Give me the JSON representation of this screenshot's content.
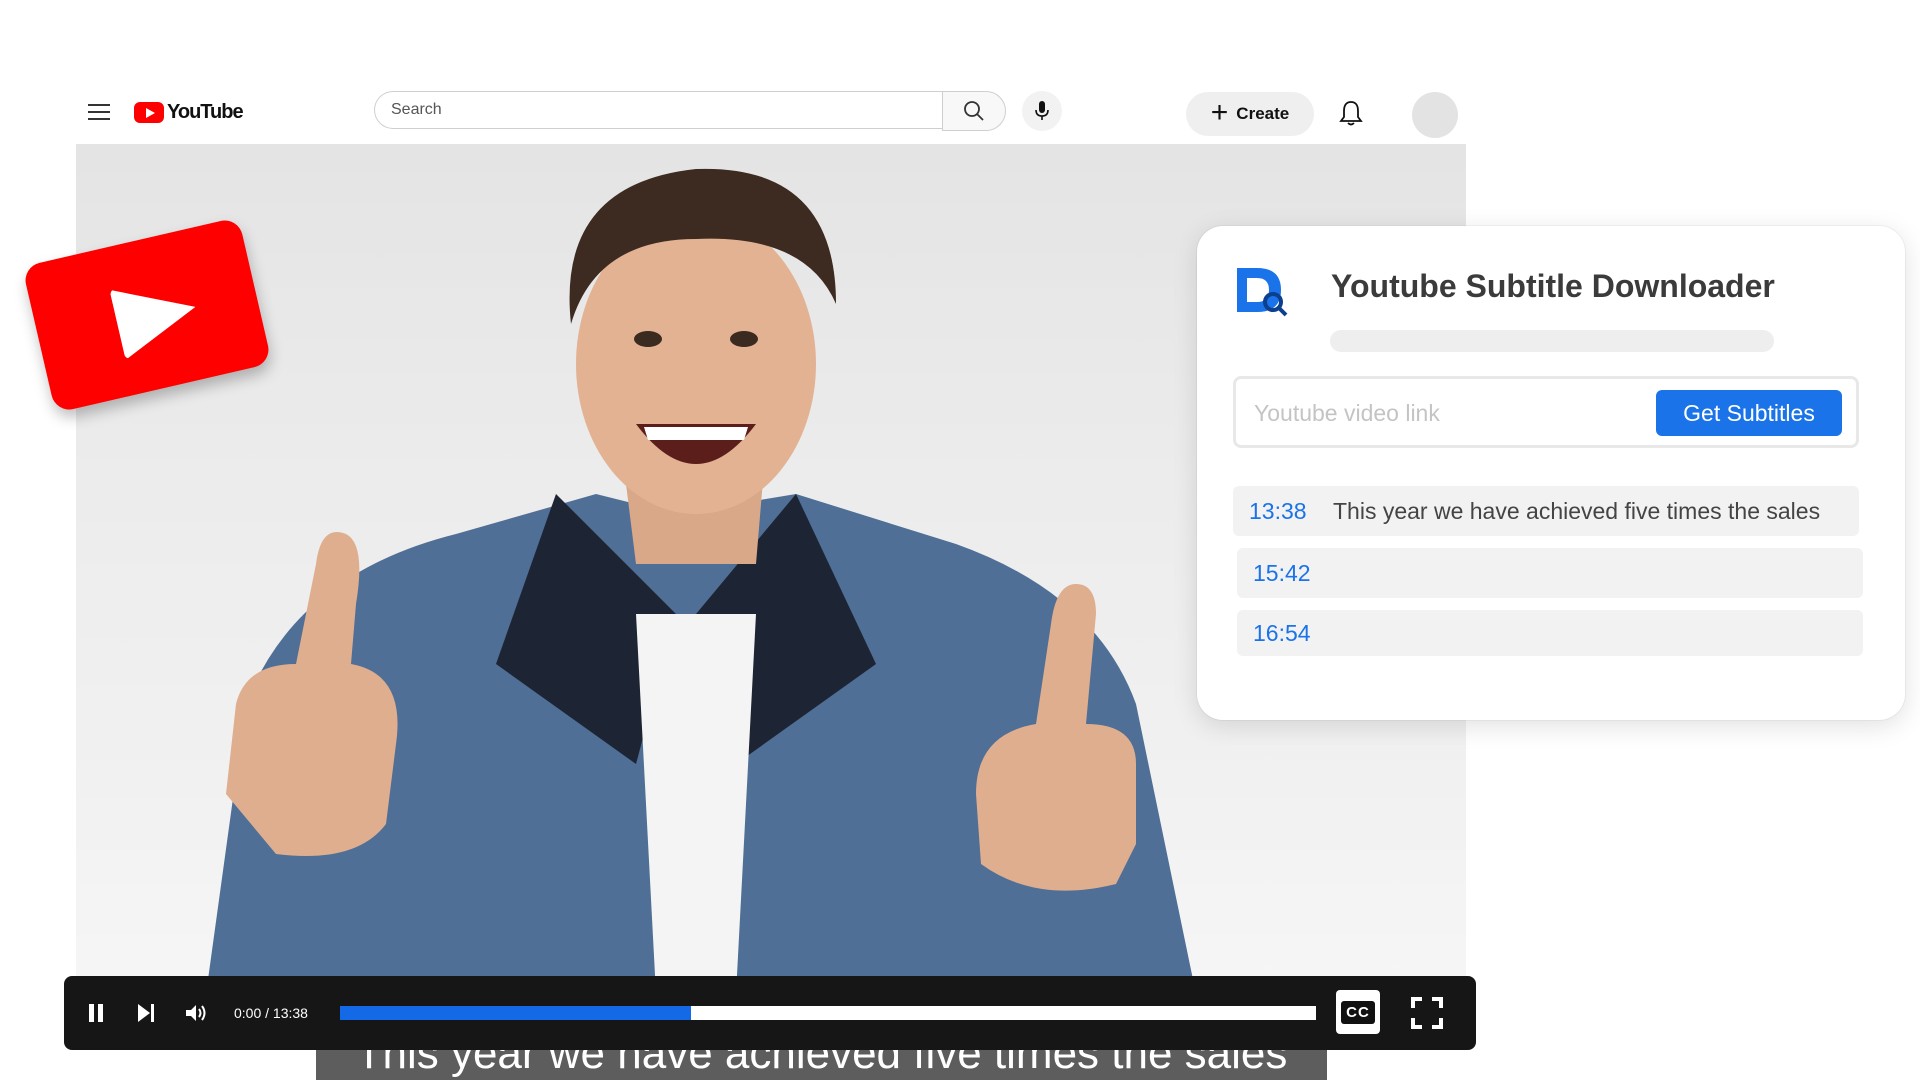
{
  "topbar": {
    "logo_text": "YouTube",
    "search_placeholder": "Search",
    "create_label": "Create"
  },
  "player": {
    "caption": "This year we have achieved five times the sales",
    "time_display": "0:00 / 13:38",
    "progress_fraction": 0.36,
    "cc_label": "CC"
  },
  "downloader": {
    "title": "Youtube Subtitle Downloader",
    "input_placeholder": "Youtube video link",
    "button_label": "Get Subtitles",
    "rows": [
      {
        "timestamp": "13:38",
        "text": "This year we have achieved five times the sales"
      },
      {
        "timestamp": "15:42",
        "text": ""
      },
      {
        "timestamp": "16:54",
        "text": ""
      }
    ]
  },
  "colors": {
    "youtube_red": "#ff0000",
    "accent_blue": "#1a73e8",
    "progress_blue": "#1469e6"
  },
  "icons": {
    "menu": "hamburger-icon",
    "search": "search-icon",
    "mic": "microphone-icon",
    "bell": "bell-icon",
    "pause": "pause-icon",
    "next": "next-icon",
    "volume": "volume-icon",
    "fullscreen": "fullscreen-icon"
  }
}
